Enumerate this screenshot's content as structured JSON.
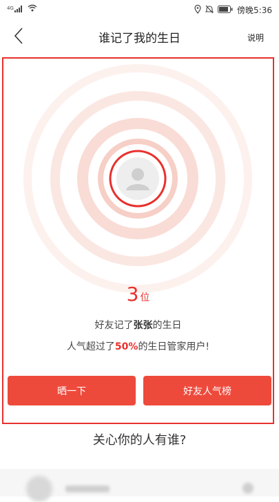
{
  "status_bar": {
    "network": "4G",
    "time": "傍晚5:36"
  },
  "header": {
    "title": "谁记了我的生日",
    "help_label": "说明"
  },
  "card": {
    "count": "3",
    "count_unit": "位",
    "line1_prefix": "好友记了",
    "line1_name": "张张",
    "line1_suffix": "的生日",
    "line2_prefix": "人气超过了",
    "line2_percent": "50%",
    "line2_suffix": "的生日管家用户!",
    "share_button": "晒一下",
    "ranking_button": "好友人气榜"
  },
  "section": {
    "title": "关心你的人有谁?"
  },
  "colors": {
    "accent": "#e8302c",
    "button": "#ee4a3c"
  },
  "icons": [
    "signal-icon",
    "wifi-icon",
    "location-icon",
    "mute-icon",
    "battery-icon",
    "back-icon",
    "user-avatar-icon"
  ]
}
